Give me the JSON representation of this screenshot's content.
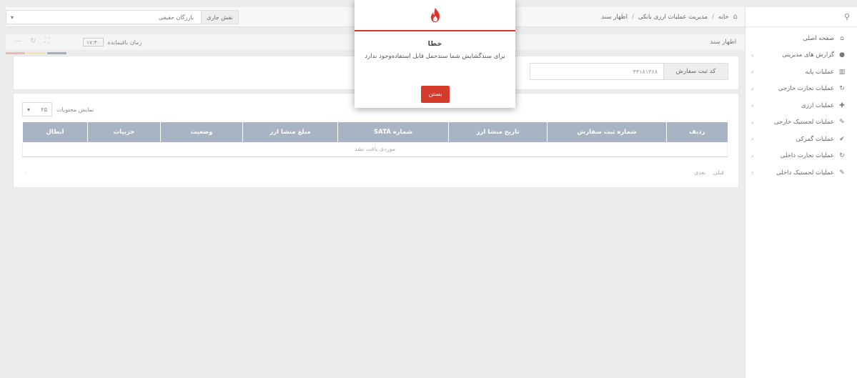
{
  "sidebar": {
    "search_icon": "search-icon",
    "items": [
      {
        "label": "صفحه اصلی",
        "icon": "⌂",
        "has_chevron": false
      },
      {
        "label": "گزارش های مدیریتی",
        "icon": "●",
        "has_chevron": true
      },
      {
        "label": "عملیات پایه",
        "icon": "▥",
        "has_chevron": true
      },
      {
        "label": "عملیات تجارت خارجی",
        "icon": "↻",
        "has_chevron": true
      },
      {
        "label": "عملیات ارزی",
        "icon": "✚",
        "has_chevron": true
      },
      {
        "label": "عملیات لجستیک خارجی",
        "icon": "✎",
        "has_chevron": true
      },
      {
        "label": "عملیات گمرکی",
        "icon": "✔",
        "has_chevron": true
      },
      {
        "label": "عملیات تجارت داخلی",
        "icon": "↻",
        "has_chevron": true
      },
      {
        "label": "عملیات لجستیک داخلی",
        "icon": "✎",
        "has_chevron": true
      }
    ]
  },
  "breadcrumb": {
    "home": "خانه",
    "level1": "مدیریت عملیات ارزی بانکی",
    "level2": "اظهار سند",
    "separator": "/"
  },
  "role": {
    "label": "نقش جاری",
    "value": "بازرگان حقیقی"
  },
  "subbar": {
    "page_heading": "اظهار سند",
    "timer_label": "زمان باقیمانده",
    "timer_value": "۱۷:۳۰"
  },
  "color_strips": [
    "#9fb0c4",
    "#f3e3a8",
    "#f2b7b1"
  ],
  "order_form": {
    "label": "کد ثبت سفارش",
    "value": "۴۴۱۸۱۳۶۸"
  },
  "table": {
    "page_size_label": "نمایش محتویات",
    "page_size_value": "۲۵",
    "columns": [
      "ردیف",
      "شماره ثبت سفارش",
      "تاریخ منشا ارز",
      "شماره SATA",
      "مبلغ منشا ارز",
      "وضعیت",
      "جزییات",
      "ابطال"
    ],
    "empty_message": "موردی یافت نشد",
    "pager_prev": "قبلی",
    "pager_next": "بعدی",
    "count": "۰"
  },
  "modal": {
    "title": "خطا",
    "message": "برای سندگشایش شما سندحمل قابل استفاده‌وجود ندارد",
    "close_label": "بستن",
    "accent_color": "#d8352b"
  }
}
